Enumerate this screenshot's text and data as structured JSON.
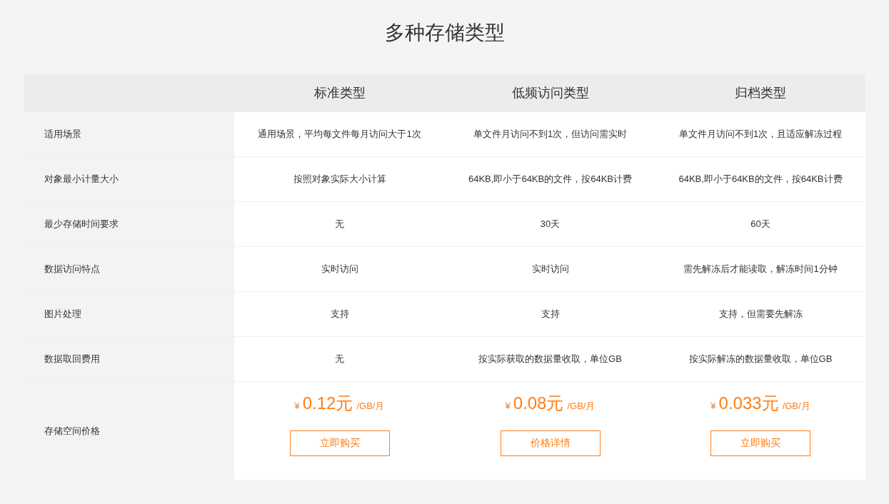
{
  "title": "多种存储类型",
  "table": {
    "columns": [
      "标准类型",
      "低频访问类型",
      "归档类型"
    ],
    "rows": [
      {
        "label": "适用场景",
        "cells": [
          "通用场景，平均每文件每月访问大于1次",
          "单文件月访问不到1次，但访问需实时",
          "单文件月访问不到1次，且适应解冻过程"
        ]
      },
      {
        "label": "对象最小计量大小",
        "cells": [
          "按照对象实际大小计算",
          "64KB,即小于64KB的文件，按64KB计费",
          "64KB,即小于64KB的文件，按64KB计费"
        ]
      },
      {
        "label": "最少存储时间要求",
        "cells": [
          "无",
          "30天",
          "60天"
        ]
      },
      {
        "label": "数据访问特点",
        "cells": [
          "实时访问",
          "实时访问",
          "需先解冻后才能读取，解冻时间1分钟"
        ]
      },
      {
        "label": "图片处理",
        "cells": [
          "支持",
          "支持",
          "支持，但需要先解冻"
        ]
      },
      {
        "label": "数据取回费用",
        "cells": [
          "无",
          "按实际获取的数据量收取，单位GB",
          "按实际解冻的数据量收取，单位GB"
        ]
      }
    ],
    "price_row": {
      "label": "存储空间价格",
      "prices": [
        {
          "currency": "¥",
          "amount": "0.12元",
          "unit": "/GB/月",
          "button": "立即购买"
        },
        {
          "currency": "¥",
          "amount": "0.08元",
          "unit": "/GB/月",
          "button": "价格详情"
        },
        {
          "currency": "¥",
          "amount": "0.033元",
          "unit": "/GB/月",
          "button": "立即购买"
        }
      ]
    }
  }
}
